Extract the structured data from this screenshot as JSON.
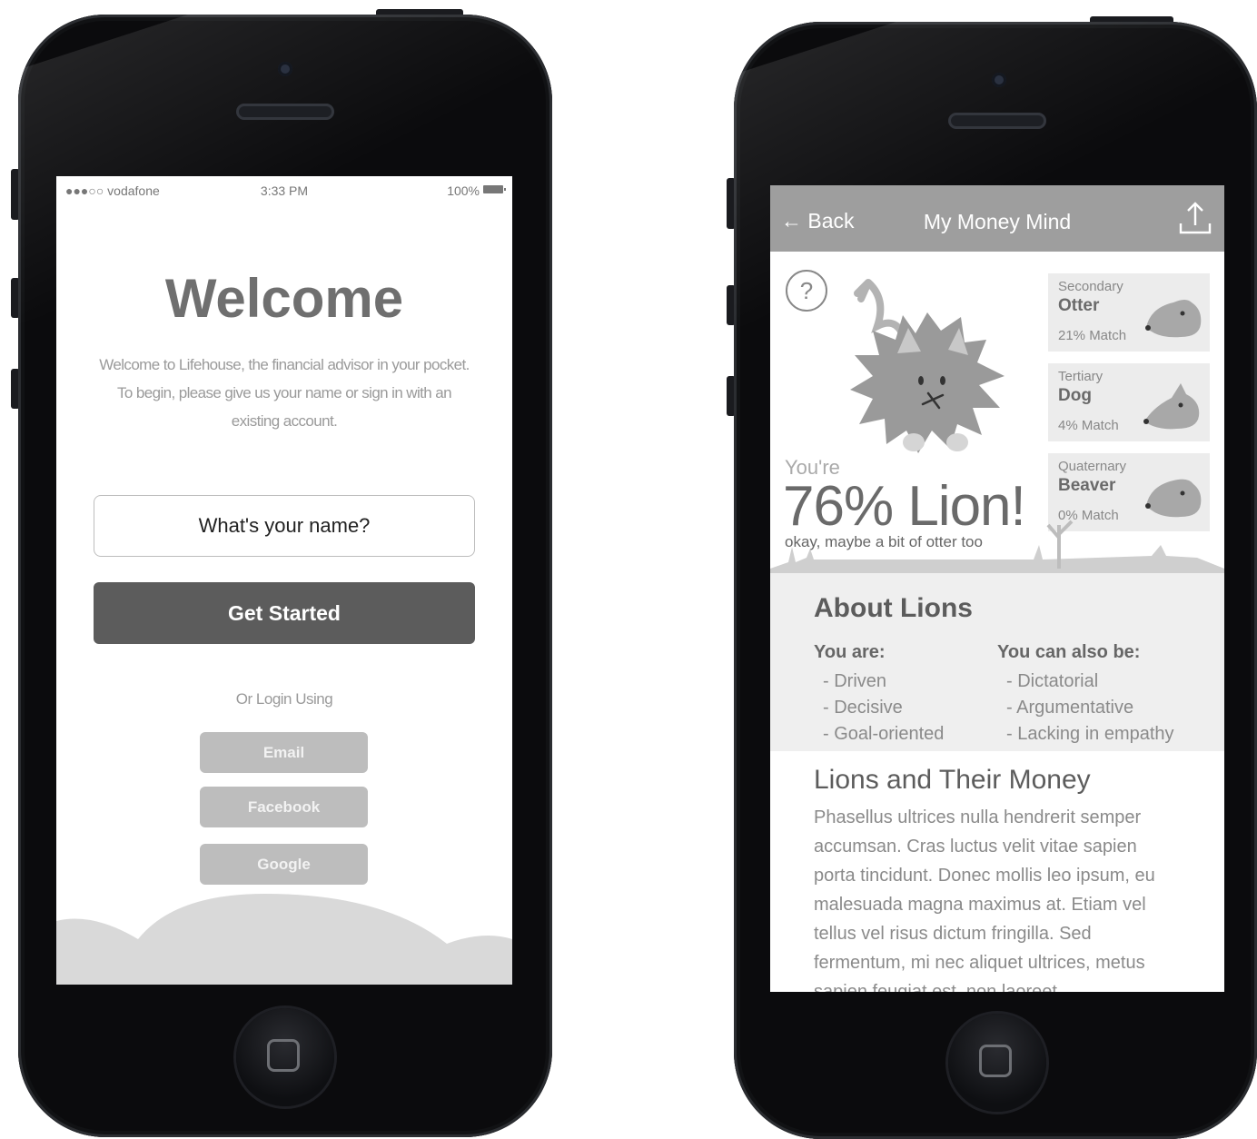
{
  "left_phone": {
    "status_bar": {
      "carrier": "●●●○○ vodafone",
      "time": "3:33 PM",
      "battery": "100%"
    },
    "title": "Welcome",
    "intro": "Welcome to Lifehouse, the financial advisor in your pocket. To begin, please give us your name or sign in with an existing account.",
    "name_input": {
      "placeholder": "What's your name?",
      "value": ""
    },
    "get_started_label": "Get Started",
    "or_login_label": "Or Login Using",
    "login_buttons": [
      "Email",
      "Facebook",
      "Google"
    ]
  },
  "right_phone": {
    "nav": {
      "back_label": "← Back",
      "title": "My Money Mind",
      "share_icon": "share-icon"
    },
    "result": {
      "youre": "You're",
      "headline": "76% Lion!",
      "subline": "okay, maybe a bit of otter too"
    },
    "matches": [
      {
        "rank": "Secondary",
        "animal": "Otter",
        "match": "21% Match"
      },
      {
        "rank": "Tertiary",
        "animal": "Dog",
        "match": "4% Match"
      },
      {
        "rank": "Quaternary",
        "animal": "Beaver",
        "match": "0% Match"
      }
    ],
    "about": {
      "title": "About Lions",
      "you_are_label": "You are:",
      "you_are": [
        "- Driven",
        "- Decisive",
        "- Goal-oriented"
      ],
      "also_label": "You can also be:",
      "also": [
        "- Dictatorial",
        "- Argumentative",
        "- Lacking in empathy"
      ]
    },
    "money": {
      "title": "Lions and Their Money",
      "text": "Phasellus ultrices nulla hendrerit semper accumsan. Cras luctus velit vitae sapien porta tincidunt. Donec mollis leo ipsum, eu malesuada magna maximus at. Etiam vel tellus vel risus dictum fringilla. Sed fermentum, mi nec aliquet ultrices, metus sapien feugiat est, non laoreet"
    }
  }
}
